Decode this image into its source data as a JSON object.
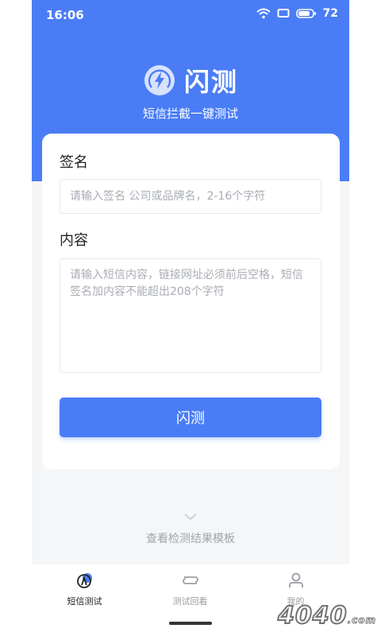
{
  "status": {
    "time": "16:06",
    "battery": "72",
    "icons": [
      "wifi-icon",
      "screen-icon",
      "battery-icon"
    ]
  },
  "brand": {
    "logo_icon": "lightning-bolt-icon",
    "name": "闪测",
    "subtitle": "短信拦截一键测试"
  },
  "form": {
    "sign_label": "签名",
    "sign_placeholder": "请输入签名 公司或品牌名，2-16个字符",
    "content_label": "内容",
    "content_placeholder": "请输入短信内容，链接网址必须前后空格，短信签名加内容不能超出208个字符",
    "submit_label": "闪测"
  },
  "templates": {
    "icon": "chevron-down-icon",
    "label": "查看检测结果模板"
  },
  "tabs": [
    {
      "label": "短信测试",
      "icon": "radar-icon",
      "active": true
    },
    {
      "label": "测试回看",
      "icon": "swap-icon",
      "active": false
    },
    {
      "label": "我的",
      "icon": "user-icon",
      "active": false
    }
  ],
  "colors": {
    "primary": "#4a7df5",
    "background": "#f5f6f8"
  },
  "watermark": {
    "text": "4040",
    "suffix": ".com"
  }
}
